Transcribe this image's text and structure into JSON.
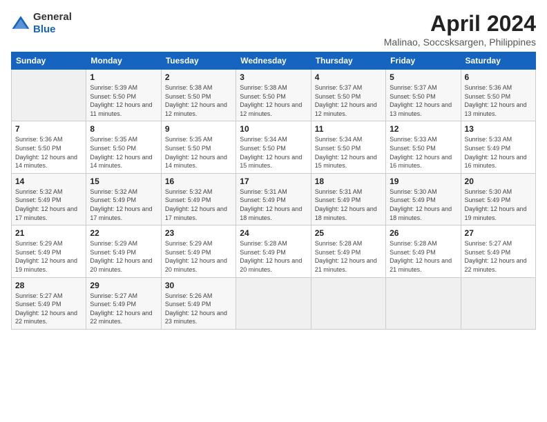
{
  "header": {
    "logo_general": "General",
    "logo_blue": "Blue",
    "month_year": "April 2024",
    "location": "Malinao, Soccsksargen, Philippines"
  },
  "weekdays": [
    "Sunday",
    "Monday",
    "Tuesday",
    "Wednesday",
    "Thursday",
    "Friday",
    "Saturday"
  ],
  "weeks": [
    [
      {
        "day": "",
        "empty": true
      },
      {
        "day": "1",
        "sunrise": "Sunrise: 5:39 AM",
        "sunset": "Sunset: 5:50 PM",
        "daylight": "Daylight: 12 hours and 11 minutes."
      },
      {
        "day": "2",
        "sunrise": "Sunrise: 5:38 AM",
        "sunset": "Sunset: 5:50 PM",
        "daylight": "Daylight: 12 hours and 12 minutes."
      },
      {
        "day": "3",
        "sunrise": "Sunrise: 5:38 AM",
        "sunset": "Sunset: 5:50 PM",
        "daylight": "Daylight: 12 hours and 12 minutes."
      },
      {
        "day": "4",
        "sunrise": "Sunrise: 5:37 AM",
        "sunset": "Sunset: 5:50 PM",
        "daylight": "Daylight: 12 hours and 12 minutes."
      },
      {
        "day": "5",
        "sunrise": "Sunrise: 5:37 AM",
        "sunset": "Sunset: 5:50 PM",
        "daylight": "Daylight: 12 hours and 13 minutes."
      },
      {
        "day": "6",
        "sunrise": "Sunrise: 5:36 AM",
        "sunset": "Sunset: 5:50 PM",
        "daylight": "Daylight: 12 hours and 13 minutes."
      }
    ],
    [
      {
        "day": "7",
        "sunrise": "Sunrise: 5:36 AM",
        "sunset": "Sunset: 5:50 PM",
        "daylight": "Daylight: 12 hours and 14 minutes."
      },
      {
        "day": "8",
        "sunrise": "Sunrise: 5:35 AM",
        "sunset": "Sunset: 5:50 PM",
        "daylight": "Daylight: 12 hours and 14 minutes."
      },
      {
        "day": "9",
        "sunrise": "Sunrise: 5:35 AM",
        "sunset": "Sunset: 5:50 PM",
        "daylight": "Daylight: 12 hours and 14 minutes."
      },
      {
        "day": "10",
        "sunrise": "Sunrise: 5:34 AM",
        "sunset": "Sunset: 5:50 PM",
        "daylight": "Daylight: 12 hours and 15 minutes."
      },
      {
        "day": "11",
        "sunrise": "Sunrise: 5:34 AM",
        "sunset": "Sunset: 5:50 PM",
        "daylight": "Daylight: 12 hours and 15 minutes."
      },
      {
        "day": "12",
        "sunrise": "Sunrise: 5:33 AM",
        "sunset": "Sunset: 5:50 PM",
        "daylight": "Daylight: 12 hours and 16 minutes."
      },
      {
        "day": "13",
        "sunrise": "Sunrise: 5:33 AM",
        "sunset": "Sunset: 5:49 PM",
        "daylight": "Daylight: 12 hours and 16 minutes."
      }
    ],
    [
      {
        "day": "14",
        "sunrise": "Sunrise: 5:32 AM",
        "sunset": "Sunset: 5:49 PM",
        "daylight": "Daylight: 12 hours and 17 minutes."
      },
      {
        "day": "15",
        "sunrise": "Sunrise: 5:32 AM",
        "sunset": "Sunset: 5:49 PM",
        "daylight": "Daylight: 12 hours and 17 minutes."
      },
      {
        "day": "16",
        "sunrise": "Sunrise: 5:32 AM",
        "sunset": "Sunset: 5:49 PM",
        "daylight": "Daylight: 12 hours and 17 minutes."
      },
      {
        "day": "17",
        "sunrise": "Sunrise: 5:31 AM",
        "sunset": "Sunset: 5:49 PM",
        "daylight": "Daylight: 12 hours and 18 minutes."
      },
      {
        "day": "18",
        "sunrise": "Sunrise: 5:31 AM",
        "sunset": "Sunset: 5:49 PM",
        "daylight": "Daylight: 12 hours and 18 minutes."
      },
      {
        "day": "19",
        "sunrise": "Sunrise: 5:30 AM",
        "sunset": "Sunset: 5:49 PM",
        "daylight": "Daylight: 12 hours and 18 minutes."
      },
      {
        "day": "20",
        "sunrise": "Sunrise: 5:30 AM",
        "sunset": "Sunset: 5:49 PM",
        "daylight": "Daylight: 12 hours and 19 minutes."
      }
    ],
    [
      {
        "day": "21",
        "sunrise": "Sunrise: 5:29 AM",
        "sunset": "Sunset: 5:49 PM",
        "daylight": "Daylight: 12 hours and 19 minutes."
      },
      {
        "day": "22",
        "sunrise": "Sunrise: 5:29 AM",
        "sunset": "Sunset: 5:49 PM",
        "daylight": "Daylight: 12 hours and 20 minutes."
      },
      {
        "day": "23",
        "sunrise": "Sunrise: 5:29 AM",
        "sunset": "Sunset: 5:49 PM",
        "daylight": "Daylight: 12 hours and 20 minutes."
      },
      {
        "day": "24",
        "sunrise": "Sunrise: 5:28 AM",
        "sunset": "Sunset: 5:49 PM",
        "daylight": "Daylight: 12 hours and 20 minutes."
      },
      {
        "day": "25",
        "sunrise": "Sunrise: 5:28 AM",
        "sunset": "Sunset: 5:49 PM",
        "daylight": "Daylight: 12 hours and 21 minutes."
      },
      {
        "day": "26",
        "sunrise": "Sunrise: 5:28 AM",
        "sunset": "Sunset: 5:49 PM",
        "daylight": "Daylight: 12 hours and 21 minutes."
      },
      {
        "day": "27",
        "sunrise": "Sunrise: 5:27 AM",
        "sunset": "Sunset: 5:49 PM",
        "daylight": "Daylight: 12 hours and 22 minutes."
      }
    ],
    [
      {
        "day": "28",
        "sunrise": "Sunrise: 5:27 AM",
        "sunset": "Sunset: 5:49 PM",
        "daylight": "Daylight: 12 hours and 22 minutes."
      },
      {
        "day": "29",
        "sunrise": "Sunrise: 5:27 AM",
        "sunset": "Sunset: 5:49 PM",
        "daylight": "Daylight: 12 hours and 22 minutes."
      },
      {
        "day": "30",
        "sunrise": "Sunrise: 5:26 AM",
        "sunset": "Sunset: 5:49 PM",
        "daylight": "Daylight: 12 hours and 23 minutes."
      },
      {
        "day": "",
        "empty": true
      },
      {
        "day": "",
        "empty": true
      },
      {
        "day": "",
        "empty": true
      },
      {
        "day": "",
        "empty": true
      }
    ]
  ]
}
